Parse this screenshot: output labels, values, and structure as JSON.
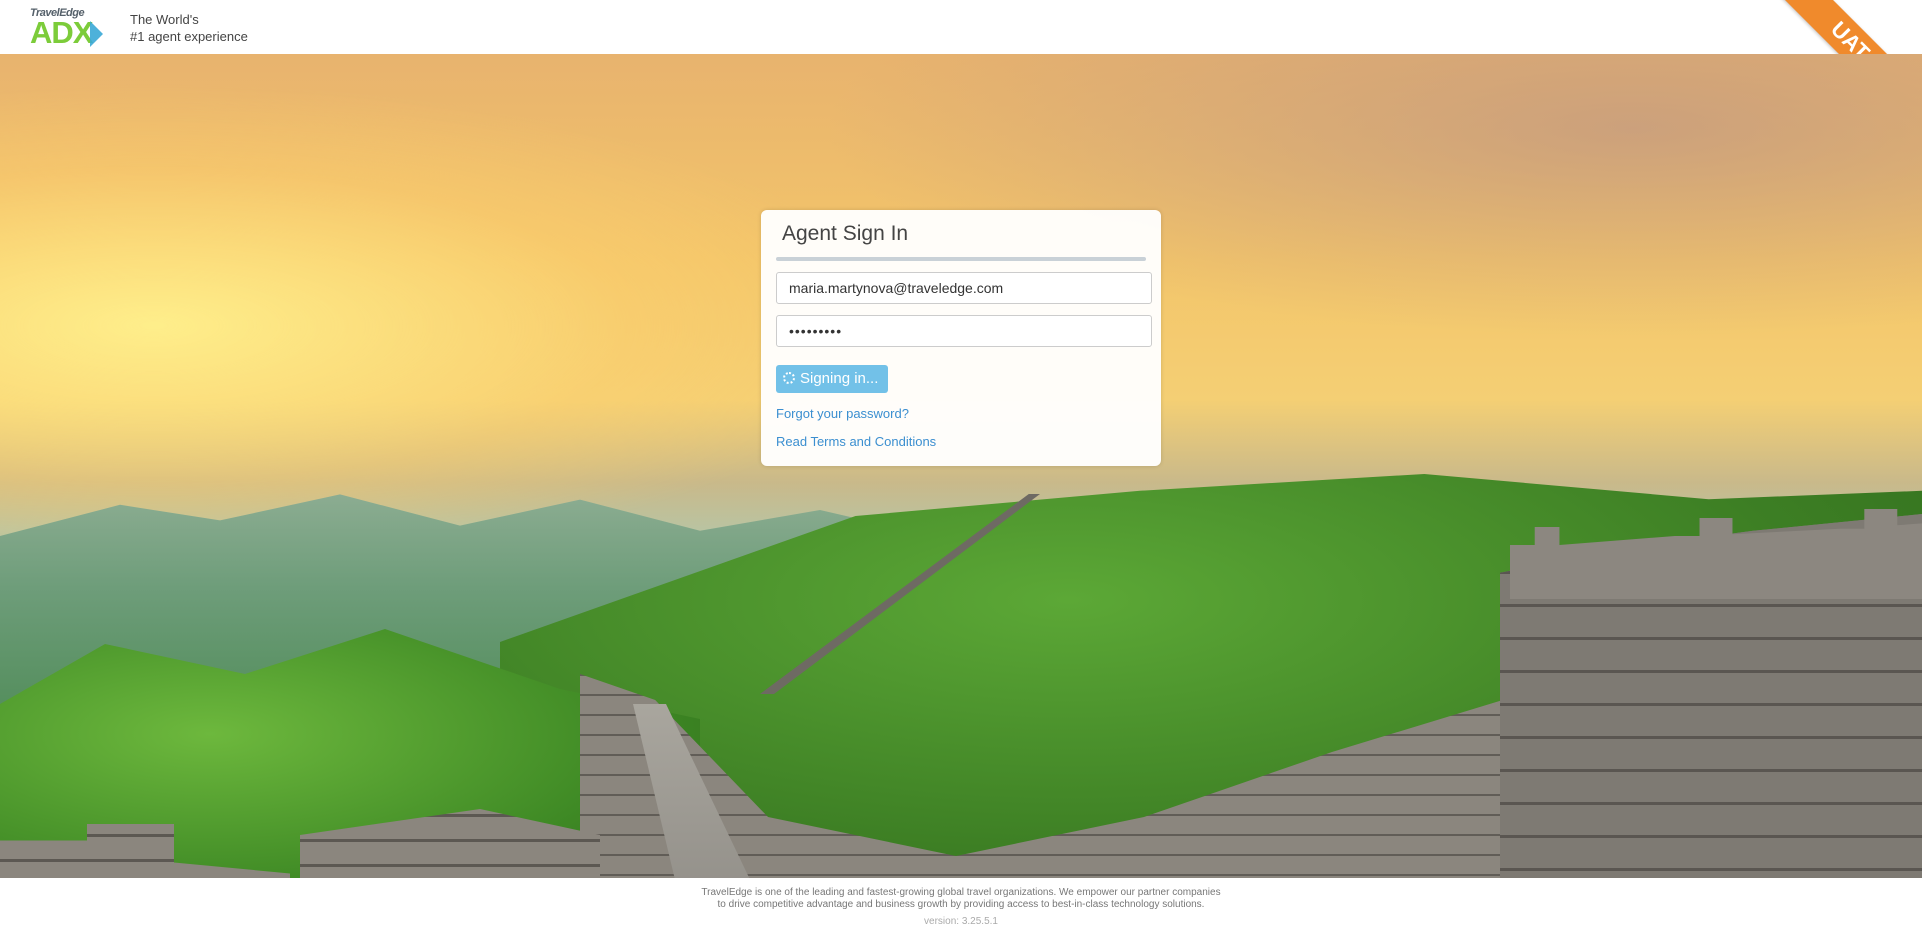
{
  "header": {
    "logo": {
      "small_text": "TravelEdge",
      "main_text": "ADX"
    },
    "tagline_line1": "The World's",
    "tagline_line2": "#1 agent experience",
    "env_ribbon": "UAT"
  },
  "signin": {
    "title": "Agent Sign In",
    "email_value": "maria.martynova@traveledge.com",
    "password_value": "•••••••••",
    "submit_label": "Signing in...",
    "forgot_link": "Forgot your password?",
    "terms_link": "Read Terms and Conditions"
  },
  "footer": {
    "line1": "TravelEdge is one of the leading and fastest-growing global travel organizations. We empower our partner companies",
    "line2": "to drive competitive advantage and business growth by providing access to best-in-class technology solutions.",
    "version": "version: 3.25.5.1"
  },
  "colors": {
    "accent_button": "#72c1e8",
    "link": "#3b8fd0",
    "ribbon": "#f08a2c",
    "logo_green": "#7ccc3a"
  },
  "icons": [
    "loading-spinner-icon"
  ]
}
